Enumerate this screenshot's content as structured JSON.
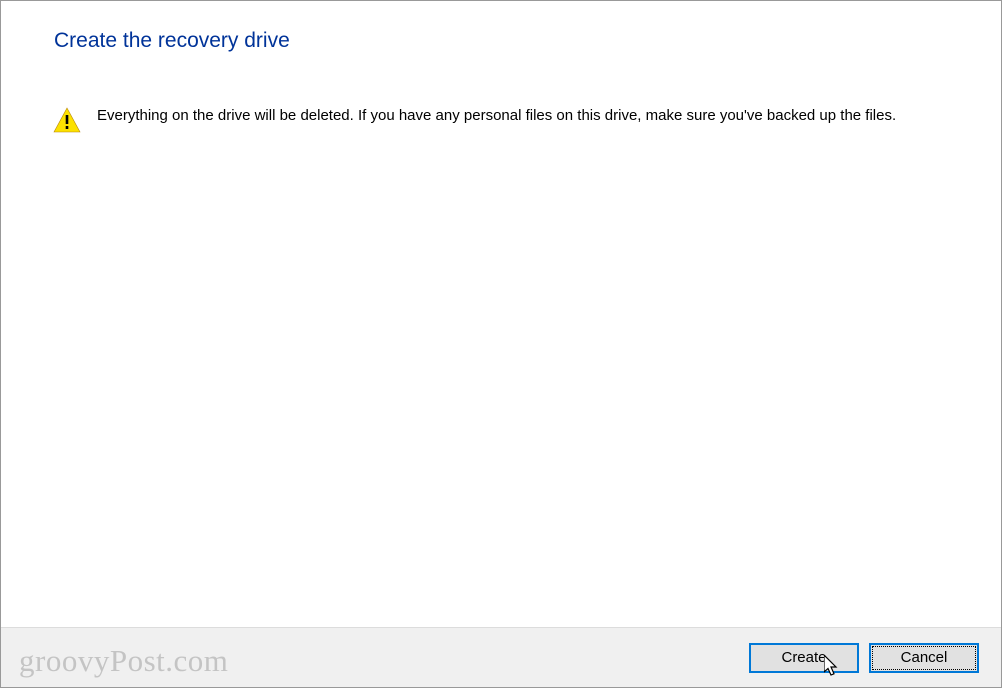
{
  "header": {
    "title": "Create the recovery drive"
  },
  "warning": {
    "message": "Everything on the drive will be deleted. If you have any personal files on this drive, make sure you've backed up the files."
  },
  "buttons": {
    "create_label": "Create",
    "cancel_label": "Cancel"
  },
  "watermark": {
    "text": "groovyPost.com"
  }
}
